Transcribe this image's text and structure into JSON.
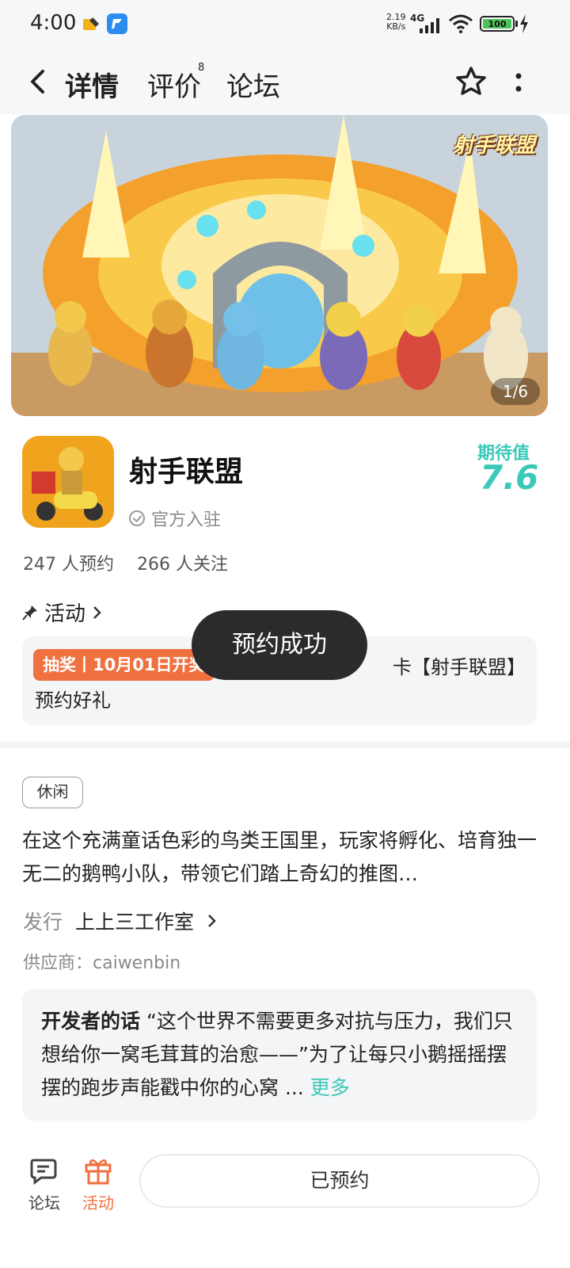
{
  "status_bar": {
    "time": "4:00",
    "net_speed_value": "2.19",
    "net_speed_unit": "KB/s",
    "network": "4G",
    "battery": "100"
  },
  "header": {
    "tabs": [
      {
        "label": "详情"
      },
      {
        "label": "评价"
      },
      {
        "label": "论坛"
      }
    ],
    "review_badge": "8",
    "accent_color": "#3ac9b8"
  },
  "banner": {
    "logo_text": "射手联盟",
    "counter": "1/6"
  },
  "app": {
    "name": "射手联盟",
    "official": "官方入驻",
    "expect_label": "期待值",
    "expect_value": "7.6",
    "reservations": "247 人预约",
    "followers": "266 人关注"
  },
  "activity": {
    "heading": "活动",
    "tag": "抽奖丨10月01日开奖",
    "text_tail": "卡【射手联盟】",
    "text_line2": "预约好礼",
    "tag_color": "#f0703f"
  },
  "toast": "预约成功",
  "details": {
    "genre": "休闲",
    "description": "在这个充满童话色彩的鸟类王国里，玩家将孵化、培育独一无二的鹅鸭小队，带领它们踏上奇幻的推图…",
    "publisher_label": "发行",
    "publisher_name": "上上三工作室",
    "supplier": "供应商：caiwenbin",
    "dev_heading": "开发者的话",
    "dev_text": "“这个世界不需要更多对抗与压力，我们只想给你一窝毛茸茸的治愈——”为了让每只小鹅摇摇摆摆的跑步声能戳中你的心窝 ...",
    "dev_more": "更多"
  },
  "bottom_bar": {
    "forum": "论坛",
    "activity": "活动",
    "reserved_button": "已预约"
  }
}
